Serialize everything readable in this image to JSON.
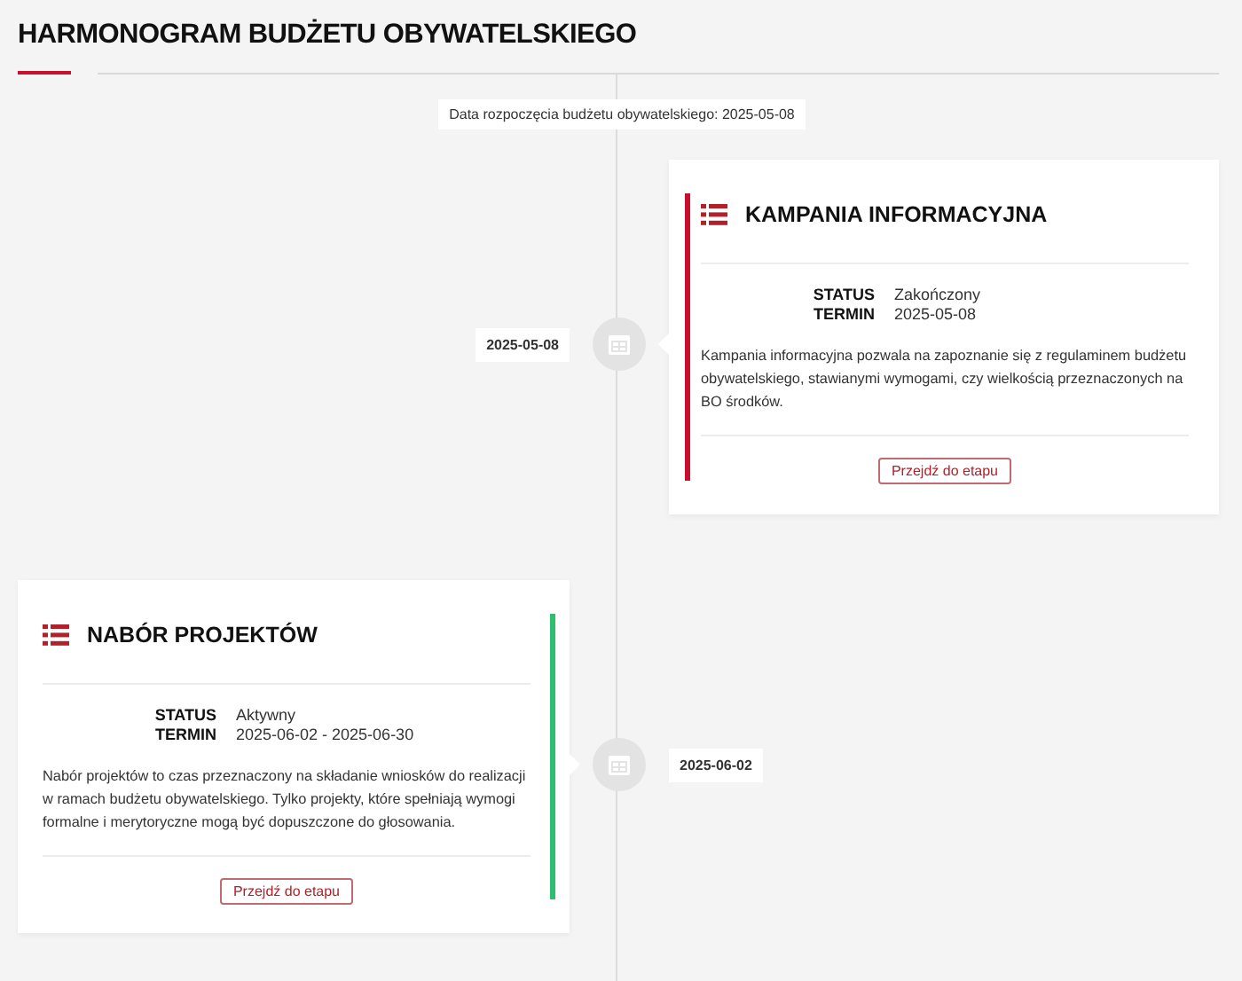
{
  "title": "HARMONOGRAM BUDŻETU OBYWATELSKIEGO",
  "start_label": "Data rozpoczęcia budżetu obywatelskiego: 2025-05-08",
  "stages": [
    {
      "date": "2025-05-08",
      "title": "KAMPANIA INFORMACYJNA",
      "status_label": "STATUS",
      "status": "Zakończony",
      "term_label": "TERMIN",
      "term": "2025-05-08",
      "description": "Kampania informacyjna pozwala na zapoznanie się z regulaminem budżetu obywatelskiego, stawianymi wymogami, czy wielkością przeznaczonych na BO środków.",
      "button": "Przejdź do etapu",
      "color": "#c8102e"
    },
    {
      "date": "2025-06-02",
      "title": "NABÓR PROJEKTÓW",
      "status_label": "STATUS",
      "status": "Aktywny",
      "term_label": "TERMIN",
      "term": "2025-06-02 - 2025-06-30",
      "description": "Nabór projektów to czas przeznaczony na składanie wniosków do realizacji w ramach budżetu obywatelskiego. Tylko projekty, które spełniają wymogi formalne i merytoryczne mogą być dopuszczone do głosowania.",
      "button": "Przejdź do etapu",
      "color": "#2dbf6f"
    }
  ]
}
